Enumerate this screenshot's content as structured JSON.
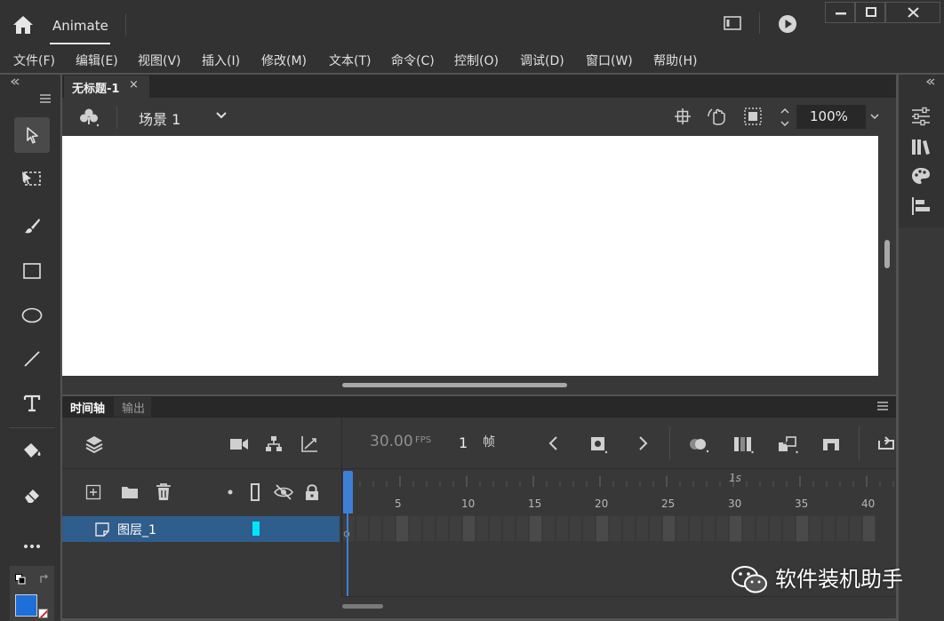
{
  "app": {
    "title": "Animate"
  },
  "menu": [
    "文件(F)",
    "编辑(E)",
    "视图(V)",
    "插入(I)",
    "修改(M)",
    "文本(T)",
    "命令(C)",
    "控制(O)",
    "调试(D)",
    "窗口(W)",
    "帮助(H)"
  ],
  "document": {
    "tab_title": "无标题-1",
    "close_glyph": "×",
    "scene_label": "场景 1",
    "zoom": "100%"
  },
  "timeline": {
    "tabs": [
      "时间轴",
      "输出"
    ],
    "fps_value": "30.00",
    "fps_unit": "FPS",
    "current_frame": "1",
    "frame_label": "帧",
    "ruler_second_label": "1s",
    "ruler_numbers": [
      "5",
      "10",
      "15",
      "20",
      "25",
      "30",
      "35",
      "40"
    ],
    "layer": {
      "name": "图层_1",
      "color": "#00e5ff"
    }
  },
  "colors": {
    "accent": "#3d7fd6",
    "layer_selected": "#2f5d8c",
    "stroke_swatch": "#1f1f1f",
    "fill_swatch": "#1e6fd9"
  },
  "icons": [
    "home-icon",
    "workspace-icon",
    "play-icon",
    "minimize-icon",
    "maximize-icon",
    "close-icon",
    "selection-tool-icon",
    "free-transform-tool-icon",
    "brush-tool-icon",
    "rectangle-tool-icon",
    "oval-tool-icon",
    "line-tool-icon",
    "text-tool-icon",
    "paint-bucket-tool-icon",
    "eraser-tool-icon",
    "more-tools-icon",
    "properties-panel-icon",
    "library-panel-icon",
    "swatches-panel-icon",
    "align-panel-icon",
    "scene-icon",
    "chevron-down-icon",
    "center-stage-icon",
    "rotate-stage-icon",
    "clip-content-icon",
    "layers-icon",
    "camera-icon",
    "layer-parenting-icon",
    "graph-icon",
    "new-layer-icon",
    "new-folder-icon",
    "delete-icon",
    "show-hide-icon",
    "lock-icon",
    "prev-frame-icon",
    "keyframe-icon",
    "next-frame-icon",
    "onion-skin-icon",
    "edit-multiple-frames-icon",
    "insert-frame-icon",
    "loop-icon"
  ],
  "watermark": "软件装机助手"
}
